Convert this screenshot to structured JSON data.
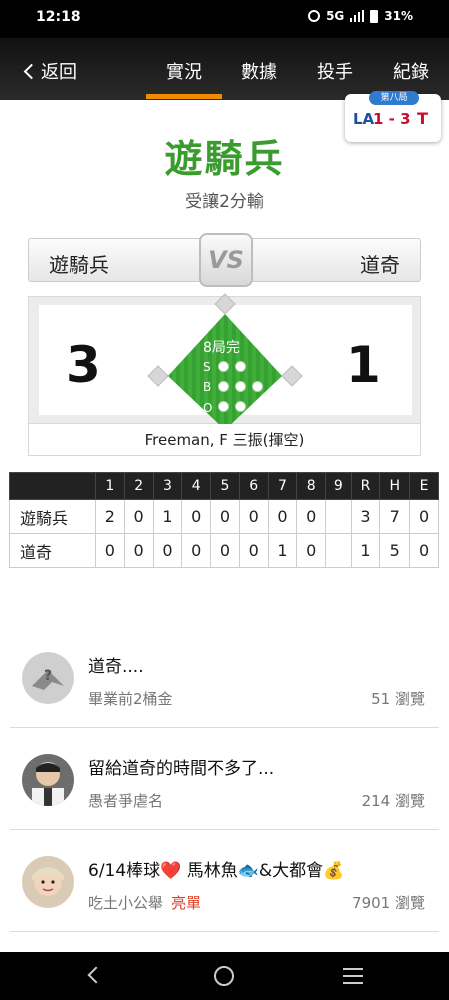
{
  "status": {
    "time": "12:18",
    "network": "5G",
    "battery": "31%"
  },
  "nav": {
    "back_label": "返回",
    "tabs": [
      {
        "label": "實況",
        "active": true
      },
      {
        "label": "數據",
        "active": false
      },
      {
        "label": "投手",
        "active": false
      },
      {
        "label": "紀錄",
        "active": false
      }
    ],
    "accent_color": "#f08a00"
  },
  "mini_score": {
    "inning": "第八局",
    "away_logo": "LA",
    "score": "1 - 3",
    "home_logo": "T"
  },
  "result": {
    "title": "遊騎兵",
    "subtitle": "受讓2分輸"
  },
  "teams": {
    "left": "遊騎兵",
    "right": "道奇",
    "vs": "VS"
  },
  "score": {
    "left": "3",
    "right": "1"
  },
  "diamond": {
    "inning_status": "8局完",
    "labels": {
      "s": "S",
      "b": "B",
      "o": "O"
    },
    "counts": {
      "strikes": 2,
      "balls": 3,
      "outs": 2
    }
  },
  "play_result": "Freeman, F 三振(揮空)",
  "linescore": {
    "headers": [
      "",
      "1",
      "2",
      "3",
      "4",
      "5",
      "6",
      "7",
      "8",
      "9",
      "R",
      "H",
      "E"
    ],
    "rows": [
      [
        "遊騎兵",
        "2",
        "0",
        "1",
        "0",
        "0",
        "0",
        "0",
        "0",
        "",
        "3",
        "7",
        "0"
      ],
      [
        "道奇",
        "0",
        "0",
        "0",
        "0",
        "0",
        "0",
        "1",
        "0",
        "",
        "1",
        "5",
        "0"
      ]
    ]
  },
  "feed": [
    {
      "title": "道奇....",
      "author": "畢業前2桶金",
      "tag": "",
      "views": "51 瀏覽",
      "avatar": "placeholder-avatar"
    },
    {
      "title": "留給道奇的時間不多了...",
      "author": "愚者爭虐名",
      "tag": "",
      "views": "214 瀏覽",
      "avatar": "man-avatar"
    },
    {
      "title": "6/14棒球❤️ 馬林魚🐟&大都會💰",
      "author": "吃土小公舉",
      "tag": "亮單",
      "views": "7901 瀏覽",
      "avatar": "woman-avatar"
    }
  ]
}
